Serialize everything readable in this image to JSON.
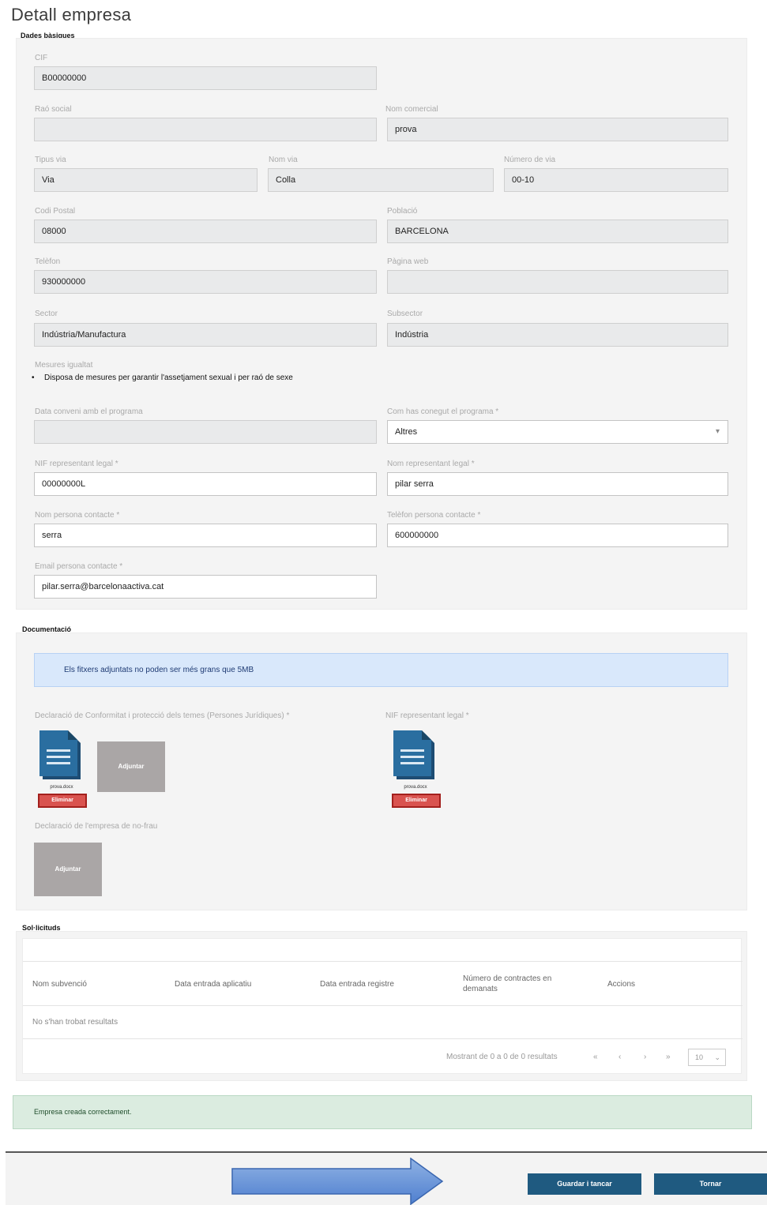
{
  "page": {
    "title": "Detall empresa"
  },
  "sections": {
    "general": "Dades bàsiques",
    "docs": "Documentació",
    "subs": "Sol·licituds"
  },
  "general": {
    "cif_label": "CIF",
    "cif_value": "B00000000",
    "social_label": "Raó social",
    "social_value": "",
    "commercial_label": "Nom comercial",
    "commercial_value": "prova",
    "via_type_label": "Tipus via",
    "via_type_value": "Via",
    "via_name_label": "Nom via",
    "via_name_value": "Colla",
    "via_number_label": "Número de via",
    "via_number_value": "00-10",
    "postal_label": "Codi Postal",
    "postal_value": "08000",
    "town_label": "Població",
    "town_value": "BARCELONA",
    "phone_label": "Telèfon",
    "phone_value": "930000000",
    "web_label": "Pàgina web",
    "web_value": "",
    "sector_label": "Sector",
    "sector_value": "Indústria/Manufactura",
    "subsector_label": "Subsector",
    "subsector_value": "Indústria",
    "measures_label": "Mesures igualtat",
    "measures_item": "Disposa de mesures per garantir l'assetjament sexual i per raó de sexe",
    "agreement_label": "Data conveni amb el programa",
    "agreement_value": "",
    "join_label": "Com has conegut el programa *",
    "join_value": "Altres",
    "rep_nif_label": "NIF representant legal *",
    "rep_nif_value": "00000000L",
    "rep_name_label": "Nom representant legal *",
    "rep_name_value": "pilar serra",
    "contact_name_label": "Nom persona contacte *",
    "contact_name_value": "serra",
    "contact_phone_label": "Telèfon persona contacte *",
    "contact_phone_value": "600000000",
    "contact_email_label": "Email persona contacte *",
    "contact_email_value": "pilar.serra@barcelonaactiva.cat"
  },
  "docs": {
    "info": "Els fitxers adjuntats no poden ser més grans que 5MB",
    "doc1_label": "Declaració de Conformitat i protecció dels temes (Persones Jurídiques) *",
    "doc1_caption": "prova.docx",
    "remove_label": "Eliminar",
    "upload_label": "Adjuntar",
    "doc2_label": "NIF representant legal *",
    "doc2_caption": "prova.docx",
    "doc3_label": "Declaració de l'empresa de no-frau"
  },
  "table": {
    "headers": [
      "Nom subvenció",
      "Data entrada aplicatiu",
      "Data entrada registre",
      "Número de contractes en demanats",
      "Accions"
    ],
    "empty": "No s'han trobat resultats",
    "pagination": "Mostrant de 0 a 0 de 0 resultats",
    "page_nav": [
      "«",
      "‹",
      "›",
      "»"
    ],
    "page_size": "10"
  },
  "alert": {
    "success": "Empresa creada correctament."
  },
  "footer": {
    "primary_label": "Guardar i tancar",
    "secondary_label": "Tornar"
  }
}
